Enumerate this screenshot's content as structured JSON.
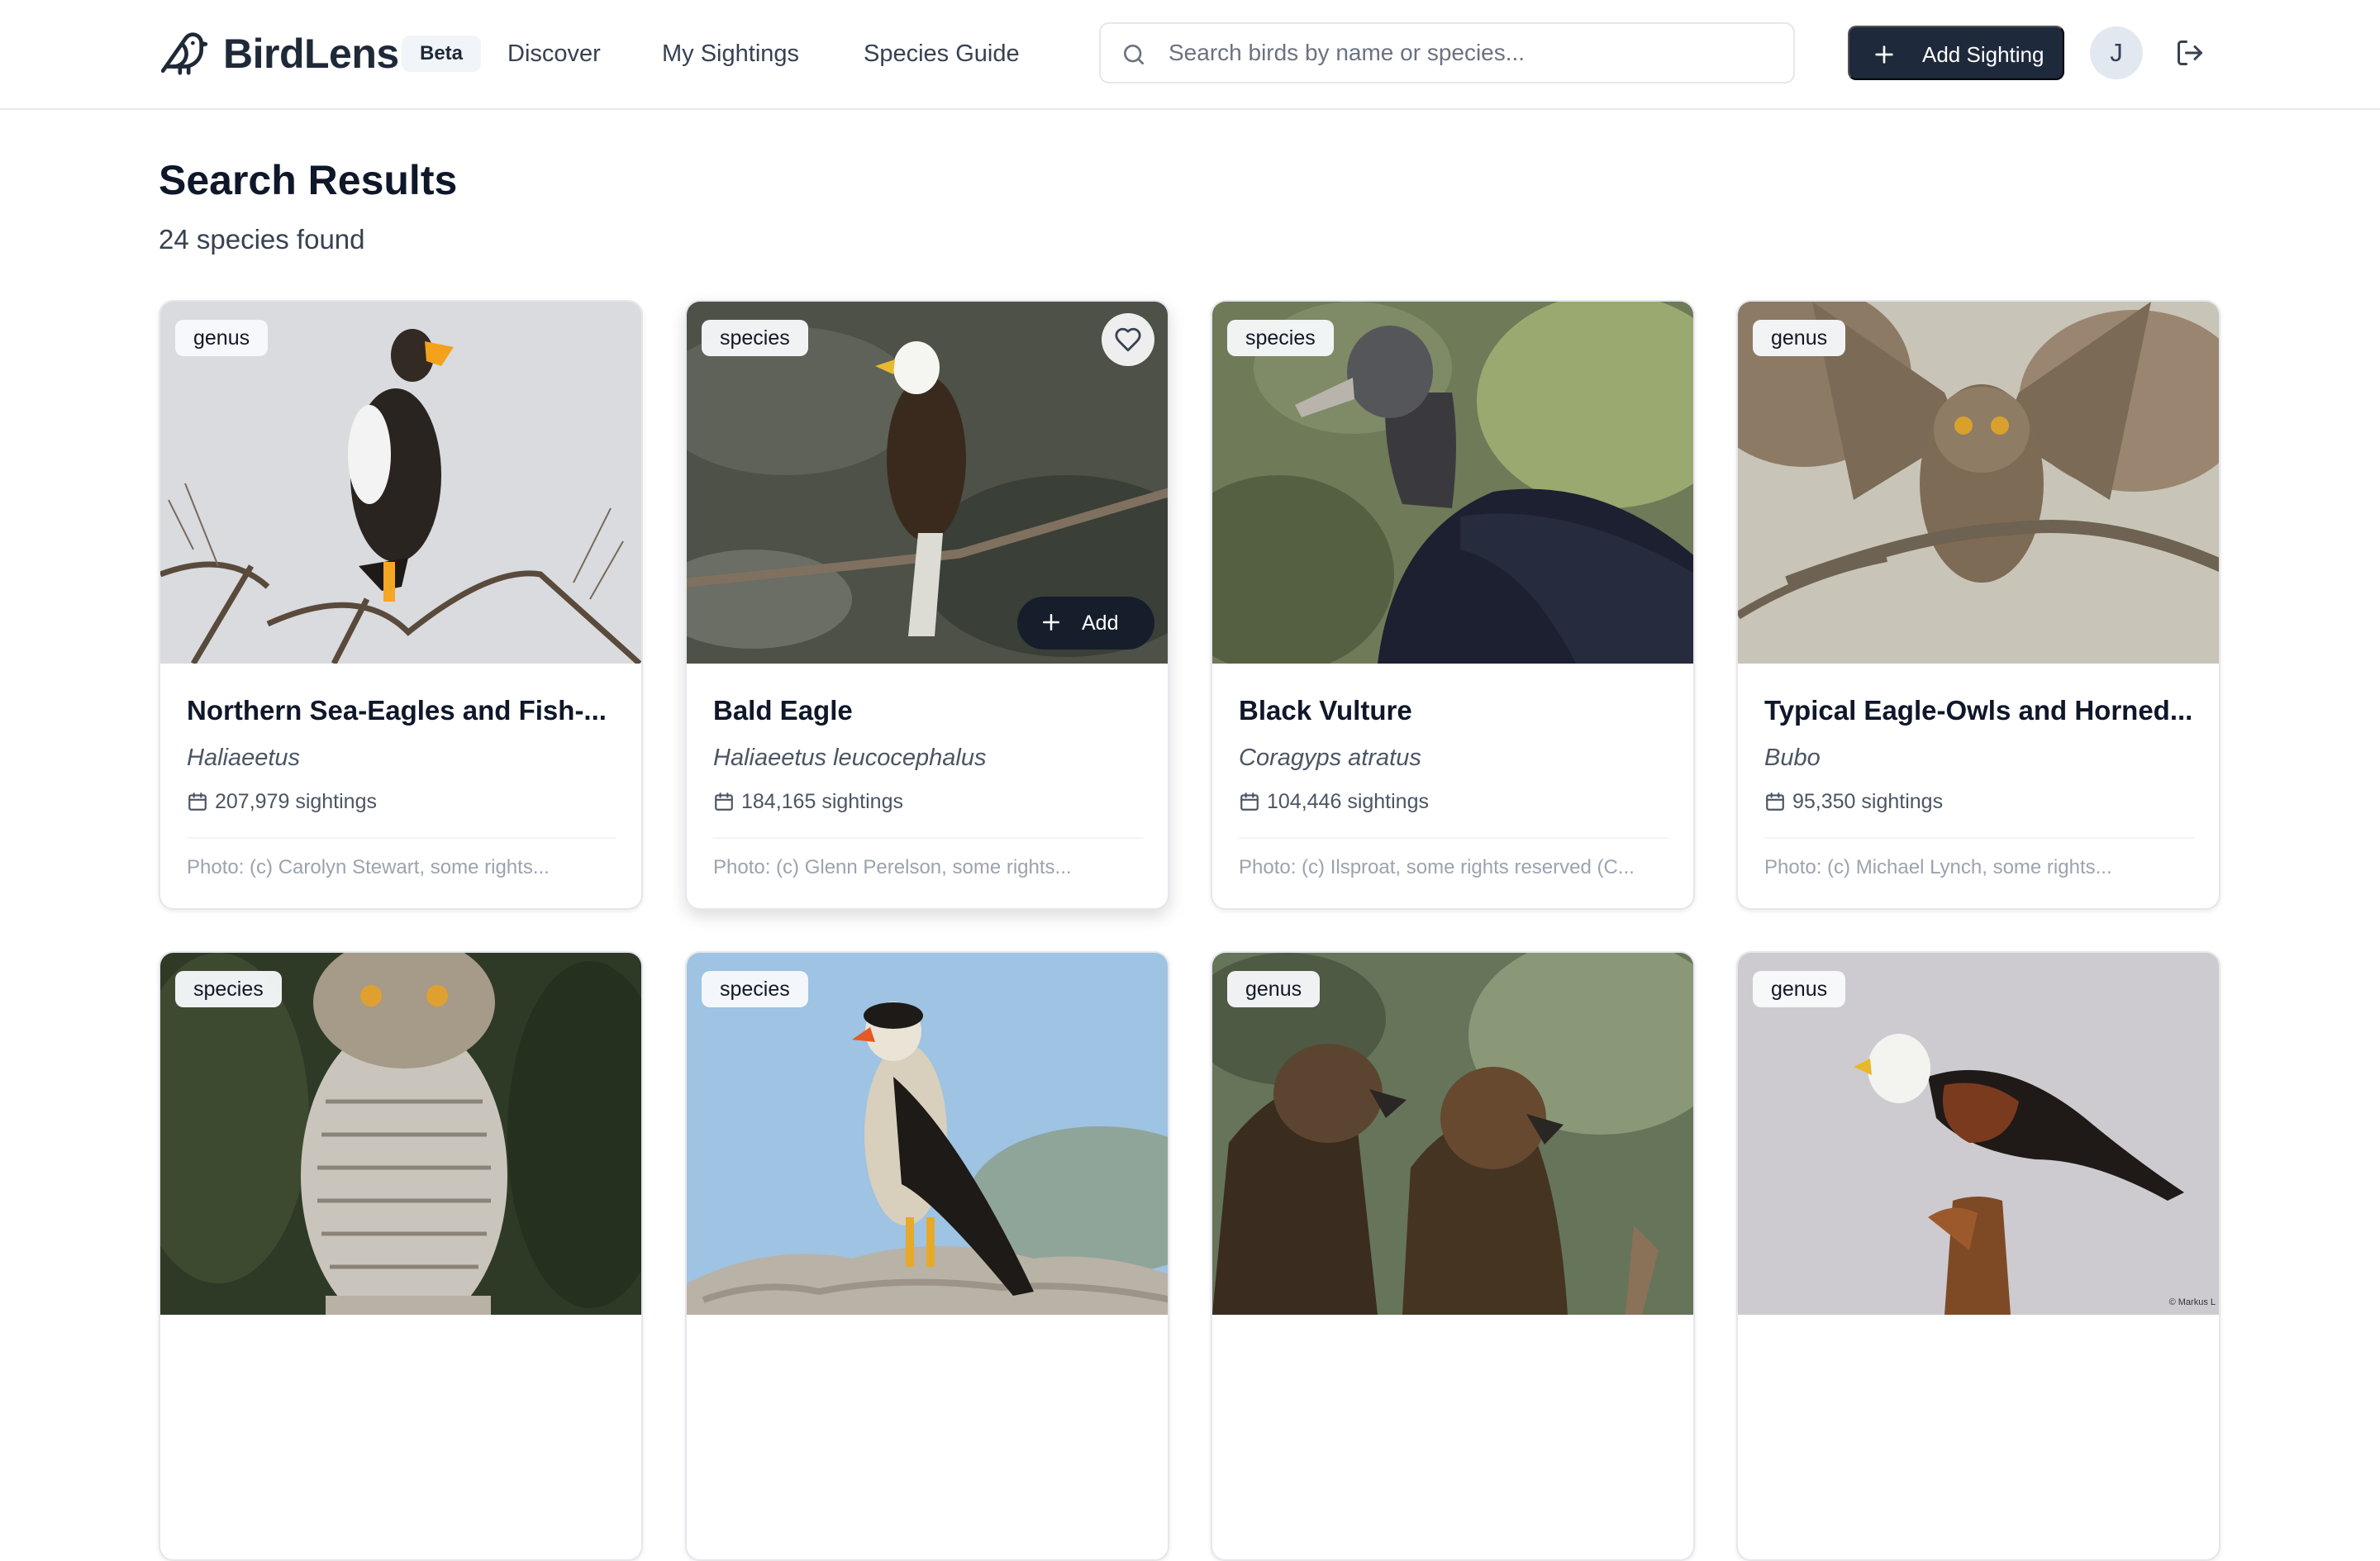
{
  "header": {
    "logo_text": "BirdLens",
    "beta_label": "Beta",
    "nav": [
      "Discover",
      "My Sightings",
      "Species Guide"
    ],
    "search_placeholder": "Search birds by name or species...",
    "add_button_label": "Add Sighting",
    "avatar_initial": "J"
  },
  "main": {
    "title": "Search Results",
    "results_count": "24 species found"
  },
  "cards": [
    {
      "rank": "genus",
      "title": "Northern Sea-Eagles and Fish-...",
      "scientific": "Haliaeetus",
      "sightings": "207,979 sightings",
      "credit": "Photo: (c) Carolyn Stewart, some rights..."
    },
    {
      "rank": "species",
      "title": "Bald Eagle",
      "scientific": "Haliaeetus leucocephalus",
      "sightings": "184,165 sightings",
      "credit": "Photo: (c) Glenn Perelson, some rights...",
      "add_label": "Add"
    },
    {
      "rank": "species",
      "title": "Black Vulture",
      "scientific": "Coragyps atratus",
      "sightings": "104,446 sightings",
      "credit": "Photo: (c) Ilsproat, some rights reserved (C..."
    },
    {
      "rank": "genus",
      "title": "Typical Eagle-Owls and Horned...",
      "scientific": "Bubo",
      "sightings": "95,350 sightings",
      "credit": "Photo: (c) Michael Lynch, some rights..."
    },
    {
      "rank": "species"
    },
    {
      "rank": "species"
    },
    {
      "rank": "genus"
    },
    {
      "rank": "genus",
      "photo_watermark": "© Markus L"
    }
  ],
  "colors": {
    "primary": "#1e293b",
    "text": "#0f172a",
    "muted": "#4b5563",
    "border": "#e5e7eb"
  },
  "icons": {
    "logo": "bird-logo-icon",
    "search": "search-icon",
    "add": "plus-icon",
    "logout": "logout-icon",
    "favorite": "heart-icon",
    "sightings": "calendar-icon"
  }
}
